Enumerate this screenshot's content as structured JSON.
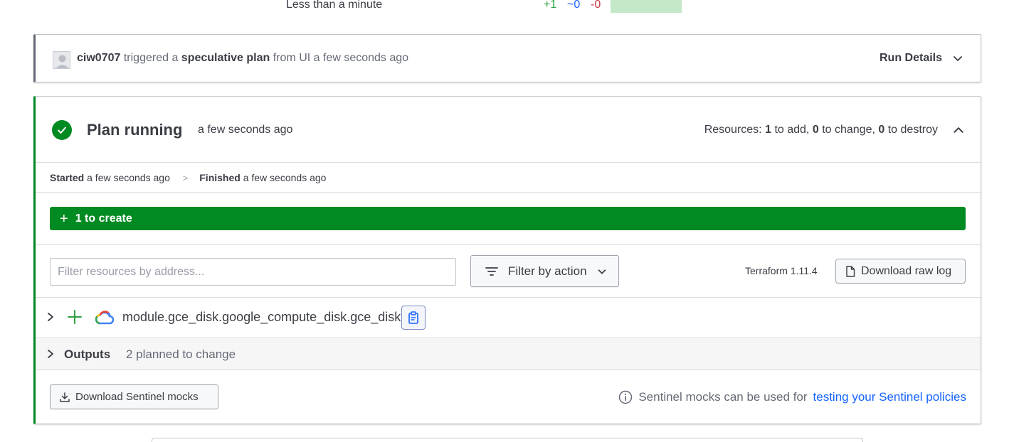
{
  "top_summary": {
    "duration": "Less than a minute",
    "add": "+1",
    "change": "~0",
    "destroy": "-0"
  },
  "trigger": {
    "user": "ciw0707",
    "text1": "triggered a",
    "plan_type": "speculative plan",
    "text2": "from UI a few seconds ago",
    "run_details_label": "Run Details"
  },
  "plan": {
    "title": "Plan running",
    "time": "a few seconds ago",
    "resources_prefix": "Resources:",
    "to_add_count": "1",
    "to_add_label": "to add,",
    "to_change_count": "0",
    "to_change_label": "to change,",
    "to_destroy_count": "0",
    "to_destroy_label": "to destroy",
    "started_label": "Started",
    "started_time": "a few seconds ago",
    "separator": ">",
    "finished_label": "Finished",
    "finished_time": "a few seconds ago",
    "create_label": "1 to create",
    "filter_placeholder": "Filter resources by address...",
    "filter_button_label": "Filter by action",
    "terraform_version": "Terraform 1.11.4",
    "download_raw_log_label": "Download raw log",
    "resource_address": "module.gce_disk.google_compute_disk.gce_disk",
    "outputs_label": "Outputs",
    "outputs_note": "2 planned to change",
    "download_mocks_label": "Download Sentinel mocks",
    "mocks_info_text": "Sentinel mocks can be used for",
    "mocks_link_text": "testing your Sentinel policies"
  },
  "colors": {
    "success_green": "#008a22",
    "link_blue": "#1563ff",
    "add_green": "#2ea043",
    "destroy_red": "#c73445"
  }
}
